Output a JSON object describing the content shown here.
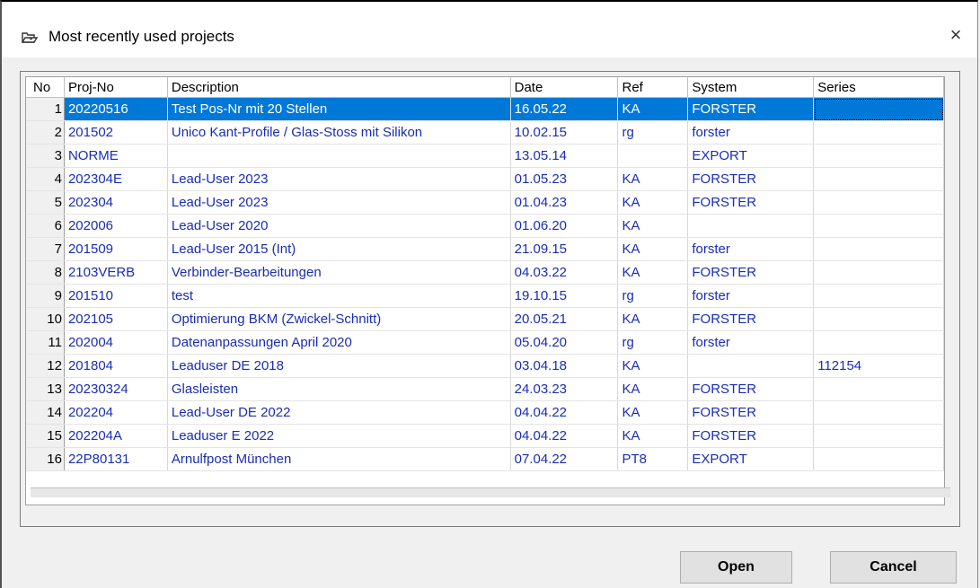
{
  "window": {
    "title": "Most recently used projects",
    "close_glyph": "×",
    "title_icon": "folder-icon"
  },
  "table": {
    "headers": {
      "no": "No",
      "proj_no": "Proj-No",
      "description": "Description",
      "date": "Date",
      "ref": "Ref",
      "system": "System",
      "series": "Series"
    },
    "rows": [
      {
        "no": "1",
        "proj_no": "20220516",
        "description": "Test Pos-Nr mit 20 Stellen",
        "date": "16.05.22",
        "ref": "KA",
        "system": "FORSTER",
        "series": ""
      },
      {
        "no": "2",
        "proj_no": "201502",
        "description": "Unico Kant-Profile / Glas-Stoss mit Silikon",
        "date": "10.02.15",
        "ref": "rg",
        "system": "forster",
        "series": ""
      },
      {
        "no": "3",
        "proj_no": "NORME",
        "description": "",
        "date": "13.05.14",
        "ref": "",
        "system": "EXPORT",
        "series": ""
      },
      {
        "no": "4",
        "proj_no": "202304E",
        "description": "Lead-User 2023",
        "date": "01.05.23",
        "ref": "KA",
        "system": "FORSTER",
        "series": ""
      },
      {
        "no": "5",
        "proj_no": "202304",
        "description": "Lead-User 2023",
        "date": "01.04.23",
        "ref": "KA",
        "system": "FORSTER",
        "series": ""
      },
      {
        "no": "6",
        "proj_no": "202006",
        "description": "Lead-User 2020",
        "date": "01.06.20",
        "ref": "KA",
        "system": "",
        "series": ""
      },
      {
        "no": "7",
        "proj_no": "201509",
        "description": "Lead-User 2015 (Int)",
        "date": "21.09.15",
        "ref": "KA",
        "system": "forster",
        "series": ""
      },
      {
        "no": "8",
        "proj_no": "2103VERB",
        "description": "Verbinder-Bearbeitungen",
        "date": "04.03.22",
        "ref": "KA",
        "system": "FORSTER",
        "series": ""
      },
      {
        "no": "9",
        "proj_no": "201510",
        "description": "test",
        "date": "19.10.15",
        "ref": "rg",
        "system": "forster",
        "series": ""
      },
      {
        "no": "10",
        "proj_no": "202105",
        "description": "Optimierung BKM (Zwickel-Schnitt)",
        "date": "20.05.21",
        "ref": "KA",
        "system": "FORSTER",
        "series": ""
      },
      {
        "no": "11",
        "proj_no": "202004",
        "description": "Datenanpassungen April 2020",
        "date": "05.04.20",
        "ref": "rg",
        "system": "forster",
        "series": ""
      },
      {
        "no": "12",
        "proj_no": "201804",
        "description": "Leaduser DE 2018",
        "date": "03.04.18",
        "ref": "KA",
        "system": "",
        "series": "112154"
      },
      {
        "no": "13",
        "proj_no": "20230324",
        "description": "Glasleisten",
        "date": "24.03.23",
        "ref": "KA",
        "system": "FORSTER",
        "series": ""
      },
      {
        "no": "14",
        "proj_no": "202204",
        "description": "Lead-User DE 2022",
        "date": "04.04.22",
        "ref": "KA",
        "system": "FORSTER",
        "series": ""
      },
      {
        "no": "15",
        "proj_no": "202204A",
        "description": "Leaduser E 2022",
        "date": "04.04.22",
        "ref": "KA",
        "system": "FORSTER",
        "series": ""
      },
      {
        "no": "16",
        "proj_no": "22P80131",
        "description": "Arnulfpost München",
        "date": "07.04.22",
        "ref": "PT8",
        "system": "EXPORT",
        "series": ""
      }
    ],
    "selected_row": 0
  },
  "buttons": {
    "open_label": "Open",
    "cancel_label": "Cancel"
  },
  "colors": {
    "selection": "#0078d7",
    "cell_text": "#1a2db5"
  }
}
